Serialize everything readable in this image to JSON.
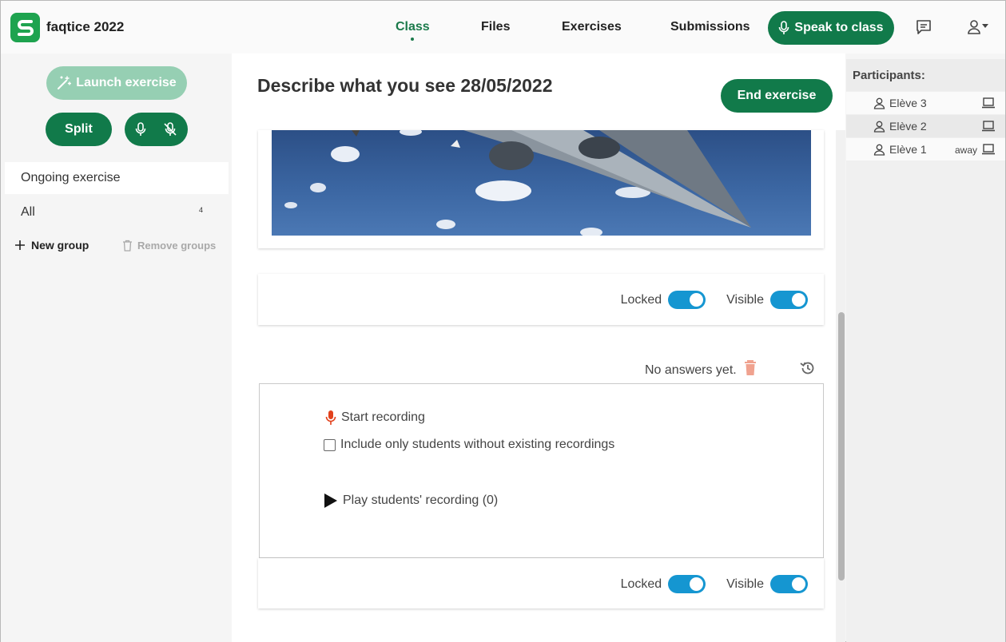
{
  "app": {
    "title": "faqtice 2022",
    "logo_letter": "S",
    "brand_color": "#117a4a"
  },
  "nav": {
    "tabs": [
      {
        "label": "Class",
        "active": true
      },
      {
        "label": "Files",
        "active": false
      },
      {
        "label": "Exercises",
        "active": false
      },
      {
        "label": "Submissions",
        "active": false
      }
    ],
    "speak_label": "Speak to class"
  },
  "sidebar": {
    "launch_label": "Launch exercise",
    "split_label": "Split",
    "groups": [
      {
        "label": "Ongoing exercise",
        "selected": true
      },
      {
        "label": "All",
        "count": "4"
      }
    ],
    "new_group_label": "New group",
    "remove_groups_label": "Remove groups"
  },
  "main": {
    "title": "Describe what you see 28/05/2022",
    "end_label": "End exercise",
    "toggles": {
      "locked_label": "Locked",
      "visible_label": "Visible",
      "locked_on": true,
      "visible_on": true
    },
    "no_answers": "No answers yet.",
    "start_recording": "Start recording",
    "include_only": "Include only students without existing recordings",
    "play_recording": "Play students' recording (0)"
  },
  "participants": {
    "header": "Participants:",
    "list": [
      {
        "name": "Elève 3",
        "status": ""
      },
      {
        "name": "Elève 2",
        "status": ""
      },
      {
        "name": "Elève 1",
        "status": "away"
      }
    ]
  }
}
